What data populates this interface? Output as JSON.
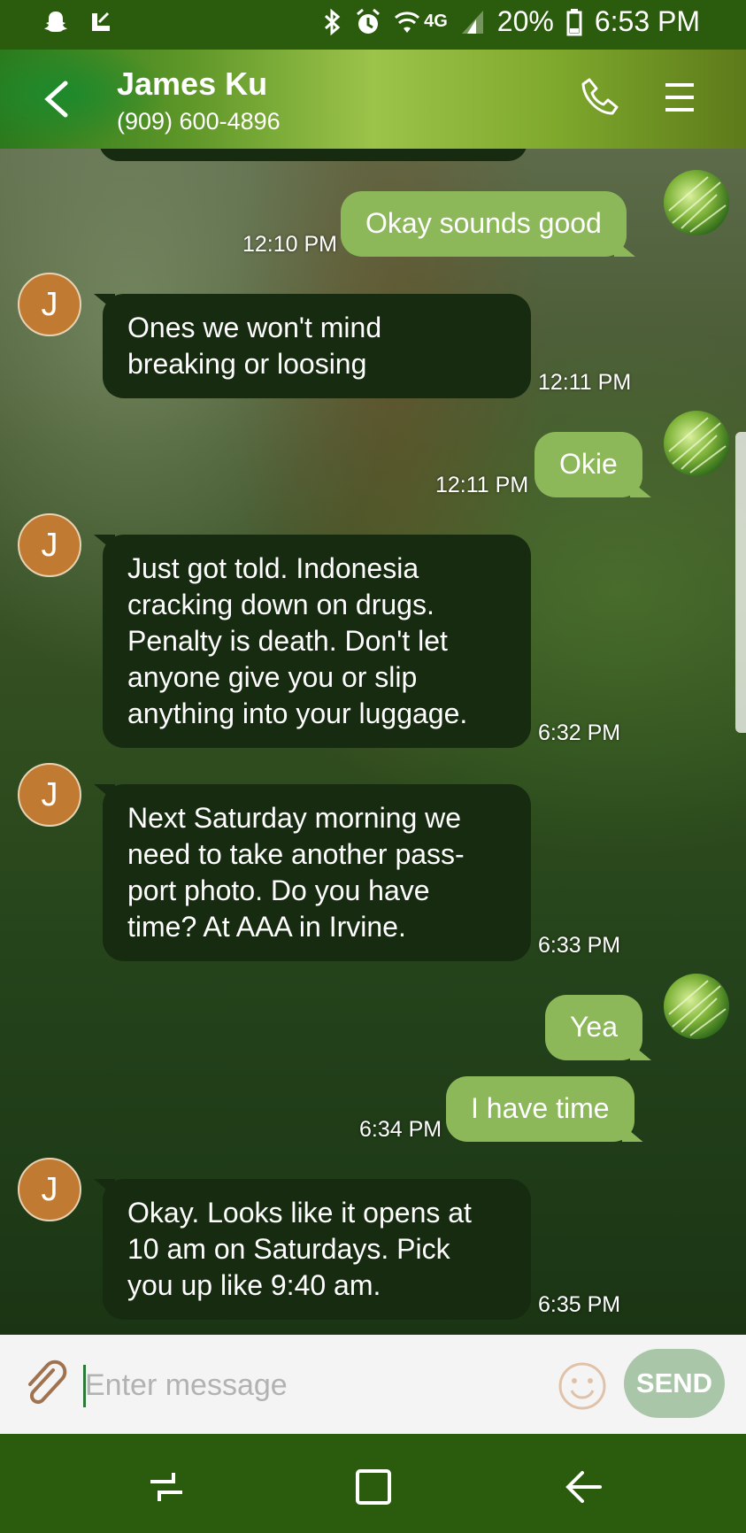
{
  "status_bar": {
    "battery": "20%",
    "time": "6:53 PM",
    "network": "4G",
    "icons": [
      "snapchat-icon",
      "missed-call-icon",
      "bluetooth-icon",
      "alarm-icon",
      "wifi-icon",
      "4g-icon",
      "signal-icon",
      "battery-icon"
    ]
  },
  "header": {
    "contact_name": "James Ku",
    "contact_phone": "(909) 600-4896",
    "icons": [
      "back-arrow-icon",
      "phone-icon",
      "menu-icon"
    ]
  },
  "conversation": {
    "contact_initial": "J",
    "messages": [
      {
        "direction": "outgoing",
        "text": "Okay sounds good",
        "time": "12:10 PM"
      },
      {
        "direction": "incoming",
        "lines": [
          "Ones we won't mind",
          "breaking or loosing"
        ],
        "time": "12:11 PM"
      },
      {
        "direction": "outgoing",
        "text": "Okie",
        "time": "12:11 PM"
      },
      {
        "direction": "incoming",
        "lines": [
          "Just got told.  Indonesia",
          "cracking down on drugs.",
          "Penalty is death.  Don't let",
          "anyone give you or slip",
          "anything into your luggage."
        ],
        "time": "6:32 PM"
      },
      {
        "direction": "incoming",
        "lines": [
          "Next Saturday morning we",
          "need to take another pass-",
          "port photo.  Do you have",
          "time? At AAA in Irvine."
        ],
        "time": "6:33 PM"
      },
      {
        "direction": "outgoing",
        "text": "Yea",
        "time": ""
      },
      {
        "direction": "outgoing",
        "text": "I have time",
        "time": "6:34 PM"
      },
      {
        "direction": "incoming",
        "lines": [
          "Okay. Looks like it opens at",
          "10 am on Saturdays. Pick",
          "you up like 9:40 am."
        ],
        "time": "6:35 PM"
      }
    ]
  },
  "composer": {
    "placeholder": "Enter message",
    "value": "",
    "send_label": "SEND",
    "icons": [
      "paperclip-icon",
      "emoji-icon"
    ]
  },
  "nav_bar": {
    "icons": [
      "recent-apps-icon",
      "home-icon",
      "back-icon"
    ]
  },
  "colors": {
    "status_bar": "#2b5b0c",
    "incoming_bubble": "#172b10",
    "outgoing_bubble": "#8cb85a",
    "avatar": "#c17a32",
    "send_button": "#a9c7a8"
  }
}
